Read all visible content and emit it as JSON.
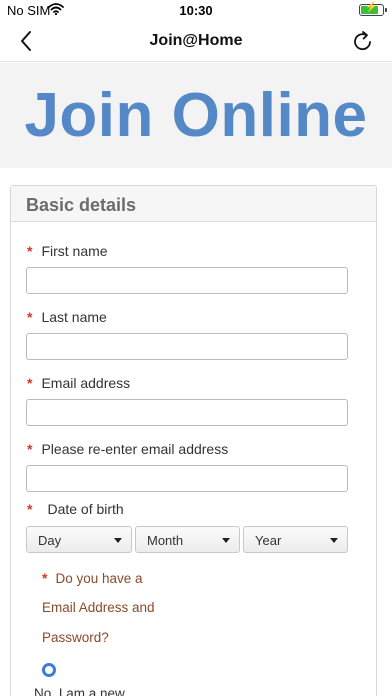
{
  "status_bar": {
    "carrier": "No SIM",
    "time": "10:30",
    "battery_level": 0.85
  },
  "nav": {
    "title": "Join@Home",
    "back_icon": "chevron-left-icon",
    "reload_icon": "reload-icon"
  },
  "banner": {
    "heading": "Join Online"
  },
  "form": {
    "section_title": "Basic details",
    "required_marker": "*",
    "first_name": {
      "label": "First name",
      "value": ""
    },
    "last_name": {
      "label": "Last name",
      "value": ""
    },
    "email": {
      "label": "Email address",
      "value": ""
    },
    "email_confirm": {
      "label": "Please re-enter email address",
      "value": ""
    },
    "dob": {
      "label": "Date of birth",
      "day": "Day",
      "month": "Month",
      "year": "Year"
    },
    "account_question": {
      "line1": "Do you have a",
      "line2": "Email Address and",
      "line3": "Password?"
    },
    "radio_option": "No, I am a new"
  }
}
